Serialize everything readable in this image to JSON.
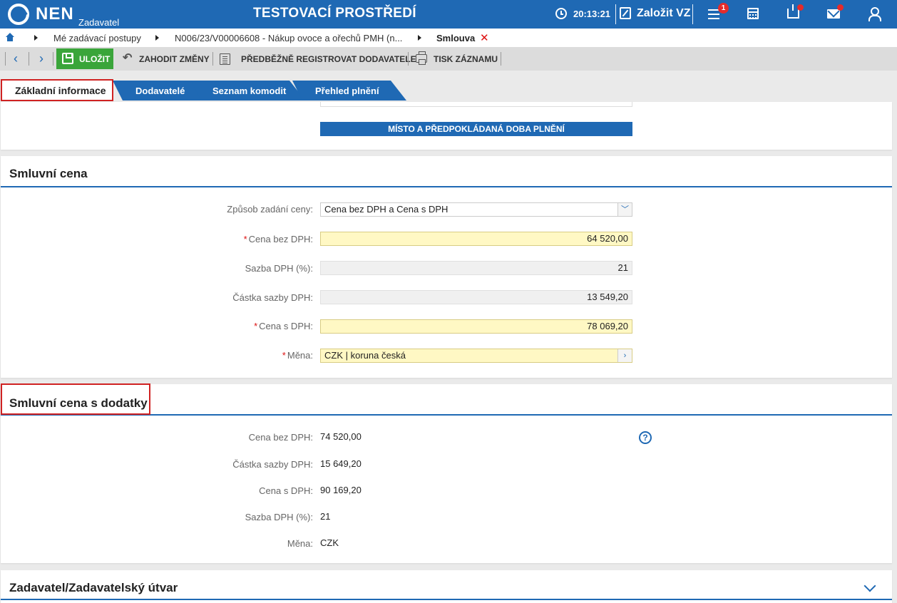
{
  "header": {
    "logo_text": "NEN",
    "logo_sub": "Zadavatel",
    "env_title": "TESTOVACÍ PROSTŘEDÍ",
    "time": "20:13:21",
    "create_label": "Založit VZ",
    "menu_badge": "1",
    "accent_color": "#1f69b4"
  },
  "breadcrumb": {
    "items": [
      "Mé zadávací postupy",
      "N006/23/V00006608 - Nákup ovoce a ořechů PMH (n...",
      "Smlouva"
    ],
    "close": "✕"
  },
  "toolbar": {
    "save": "ULOŽIT",
    "discard": "ZAHODIT ZMĚNY",
    "register": "PŘEDBĚŽNĚ REGISTROVAT DODAVATELE",
    "print": "TISK ZÁZNAMU"
  },
  "tabs": [
    "Základní informace",
    "Dodavatelé",
    "Seznam komodit",
    "Přehled plnění"
  ],
  "section_place": "MÍSTO A PŘEDPOKLÁDANÁ DOBA PLNĚNÍ",
  "contract_price": {
    "title": "Smluvní cena",
    "fields": [
      {
        "label": "Způsob zadání ceny:",
        "value": "Cena bez DPH a Cena s DPH"
      },
      {
        "label": "Cena bez DPH:",
        "value": "64 520,00"
      },
      {
        "label": "Sazba DPH (%):",
        "value": "21"
      },
      {
        "label": "Částka sazby DPH:",
        "value": "13 549,20"
      },
      {
        "label": "Cena s DPH:",
        "value": "78 069,20"
      },
      {
        "label": "Měna:",
        "value": "CZK | koruna česká"
      }
    ]
  },
  "price_amendments": {
    "title": "Smluvní cena s dodatky",
    "fields": [
      {
        "label": "Cena bez DPH:",
        "value": "74 520,00"
      },
      {
        "label": "Částka sazby DPH:",
        "value": "15 649,20"
      },
      {
        "label": "Cena s DPH:",
        "value": "90 169,20"
      },
      {
        "label": "Sazba DPH (%):",
        "value": "21"
      },
      {
        "label": "Měna:",
        "value": "CZK"
      }
    ],
    "help": "?"
  },
  "contracting": {
    "title": "Zadavatel/Zadavatelský útvar"
  }
}
